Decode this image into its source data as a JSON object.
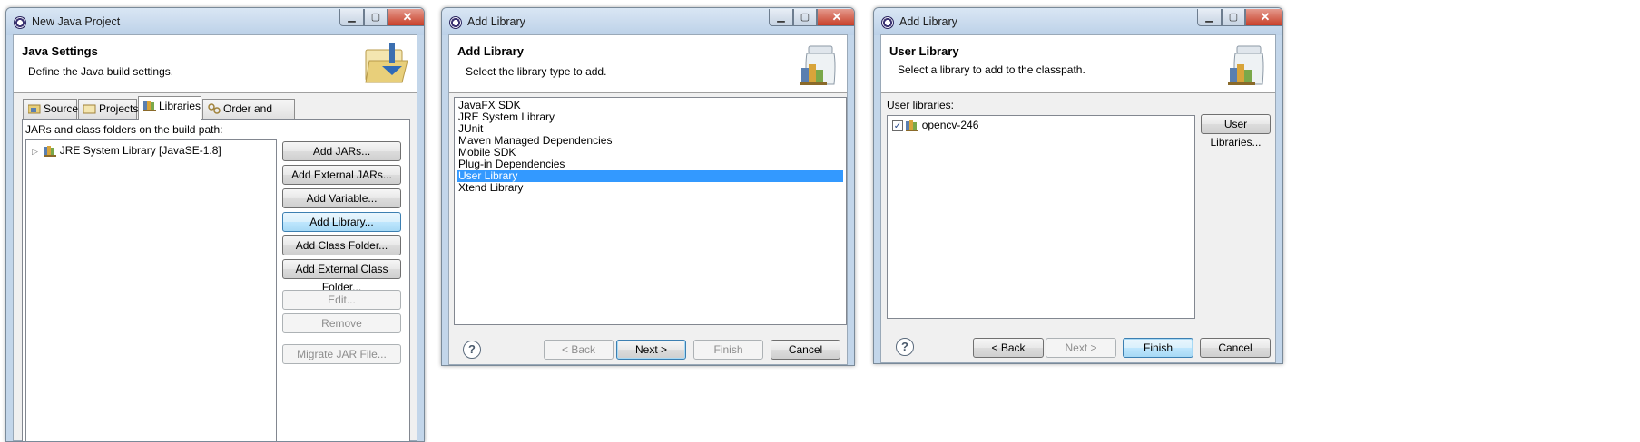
{
  "w1": {
    "title": "New Java Project",
    "header_title": "Java Settings",
    "header_desc": "Define the Java build settings.",
    "tabs": [
      {
        "label": "Source"
      },
      {
        "label": "Projects"
      },
      {
        "label": "Libraries"
      },
      {
        "label": "Order and Export"
      }
    ],
    "path_label": "JARs and class folders on the build path:",
    "tree_item": "JRE System Library [JavaSE-1.8]",
    "buttons": {
      "add_jars": "Add JARs...",
      "add_external_jars": "Add External JARs...",
      "add_variable": "Add Variable...",
      "add_library": "Add Library...",
      "add_class_folder": "Add Class Folder...",
      "add_external_class_folder": "Add External Class Folder...",
      "edit": "Edit...",
      "remove": "Remove",
      "migrate": "Migrate JAR File..."
    }
  },
  "w2": {
    "title": "Add Library",
    "header_title": "Add Library",
    "header_desc": "Select the library type to add.",
    "items": [
      "JavaFX SDK",
      "JRE System Library",
      "JUnit",
      "Maven Managed Dependencies",
      "Mobile SDK",
      "Plug-in Dependencies",
      "User Library",
      "Xtend Library"
    ],
    "selected_item": "User Library",
    "buttons": {
      "back": "< Back",
      "next": "Next >",
      "finish": "Finish",
      "cancel": "Cancel"
    }
  },
  "w3": {
    "title": "Add Library",
    "header_title": "User Library",
    "header_desc": "Select a library to add to the classpath.",
    "list_label": "User libraries:",
    "library": "opencv-246",
    "library_checked": true,
    "buttons": {
      "user_libraries": "User Libraries...",
      "back": "< Back",
      "next": "Next >",
      "finish": "Finish",
      "cancel": "Cancel"
    }
  },
  "window_controls": {
    "minimize": "▁",
    "maximize": "▢",
    "close": "✕"
  },
  "help_glyph": "?",
  "colors": {
    "selection": "#3399ff",
    "title_bar": "#c3d6ea",
    "dialog_bg": "#f0f0f0"
  }
}
